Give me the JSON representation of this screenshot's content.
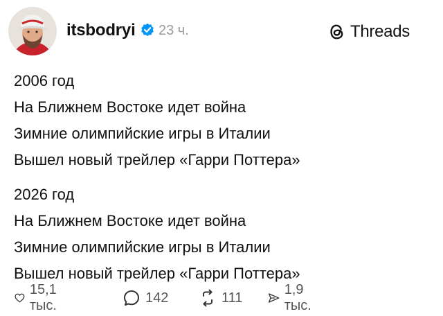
{
  "header": {
    "username": "itsbodryi",
    "time": "23 ч.",
    "brand": "Threads"
  },
  "post": {
    "lines": [
      "2006 год",
      "На Ближнем Востоке идет война",
      "Зимние олимпийские игры в Италии",
      "Вышел новый трейлер «Гарри Поттера»",
      "2026 год",
      "На Ближнем Востоке идет война",
      "Зимние олимпийские игры в Италии",
      "Вышел новый трейлер «Гарри Поттера»"
    ]
  },
  "actions": {
    "likes": "15,1 тыс.",
    "replies": "142",
    "reposts": "111",
    "shares": "1,9 тыс."
  },
  "colors": {
    "verified": "#0095f6",
    "muted": "#9a9a9a",
    "text": "#111111"
  }
}
